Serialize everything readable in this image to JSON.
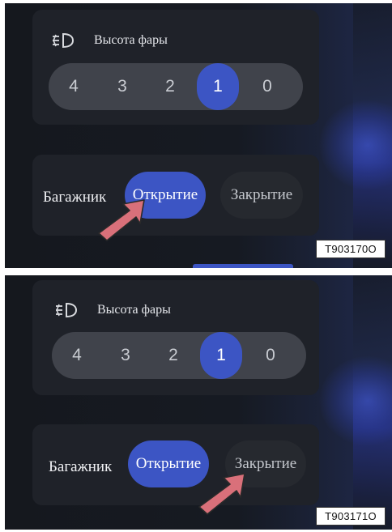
{
  "panels": [
    {
      "headlight": {
        "title": "Высота фары",
        "levels": [
          "4",
          "3",
          "2",
          "1",
          "0"
        ],
        "selected": "1"
      },
      "trunk": {
        "label": "Багажник",
        "open": "Открытие",
        "close": "Закрытие",
        "active": "open"
      },
      "code": "T903170O"
    },
    {
      "headlight": {
        "title": "Высота фары",
        "levels": [
          "4",
          "3",
          "2",
          "1",
          "0"
        ],
        "selected": "1"
      },
      "trunk": {
        "label": "Багажник",
        "open": "Открытие",
        "close": "Закрытие",
        "active": "open"
      },
      "code": "T903171O"
    }
  ],
  "colors": {
    "accent": "#3c55c4",
    "card": "#1f2229",
    "pill": "#40434b",
    "arrow": "#d9707a"
  },
  "icons": [
    "headlight-level-icon",
    "pointer-arrow-icon"
  ]
}
